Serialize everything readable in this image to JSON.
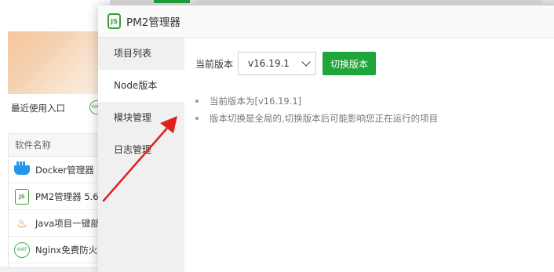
{
  "background": {
    "recent_label": "最近使用入口",
    "waf_small_icon": "WAF",
    "table_header": "软件名称",
    "rows": [
      {
        "icon": "docker-icon",
        "label": "Docker管理器"
      },
      {
        "icon": "pm2-icon",
        "icon_text": "JS",
        "label": "PM2管理器 5.6"
      },
      {
        "icon": "java-icon",
        "icon_text": "♨",
        "label": "Java项目一键部"
      },
      {
        "icon": "waf-icon",
        "icon_text": "WAF",
        "label": "Nginx免费防火"
      }
    ]
  },
  "dialog": {
    "logo_text": "JS",
    "title": "PM2管理器",
    "sidebar": [
      {
        "label": "项目列表",
        "active": false
      },
      {
        "label": "Node版本",
        "active": true
      },
      {
        "label": "模块管理",
        "active": false
      },
      {
        "label": "日志管理",
        "active": false
      }
    ],
    "version_label": "当前版本",
    "version_value": "v16.19.1",
    "switch_button": "切换版本",
    "notes": [
      "当前版本为[v16.19.1]",
      "版本切换是全局的,切换版本后可能影响您正在运行的项目"
    ]
  },
  "colors": {
    "accent_green": "#20a53a",
    "arrow_red": "#e02020"
  }
}
